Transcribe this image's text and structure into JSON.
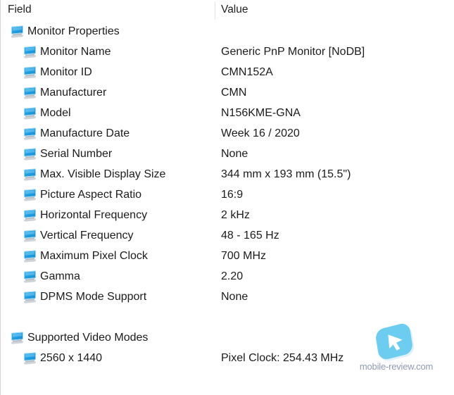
{
  "window": {
    "title": "Monitor Properties"
  },
  "table": {
    "columns": {
      "field": "Field",
      "value": "Value"
    },
    "rows": [
      {
        "level": 0,
        "icon": "monitor-icon",
        "field": "Monitor Properties",
        "value": ""
      },
      {
        "level": 1,
        "icon": "monitor-icon",
        "field": "Monitor Name",
        "value": "Generic PnP Monitor [NoDB]"
      },
      {
        "level": 1,
        "icon": "monitor-icon",
        "field": "Monitor ID",
        "value": "CMN152A"
      },
      {
        "level": 1,
        "icon": "monitor-icon",
        "field": "Manufacturer",
        "value": "CMN"
      },
      {
        "level": 1,
        "icon": "monitor-icon",
        "field": "Model",
        "value": "N156KME-GNA"
      },
      {
        "level": 1,
        "icon": "monitor-icon",
        "field": "Manufacture Date",
        "value": "Week 16 / 2020"
      },
      {
        "level": 1,
        "icon": "monitor-icon",
        "field": "Serial Number",
        "value": "None"
      },
      {
        "level": 1,
        "icon": "monitor-icon",
        "field": "Max. Visible Display Size",
        "value": "344 mm x 193 mm (15.5\")"
      },
      {
        "level": 1,
        "icon": "monitor-icon",
        "field": "Picture Aspect Ratio",
        "value": "16:9"
      },
      {
        "level": 1,
        "icon": "monitor-icon",
        "field": "Horizontal Frequency",
        "value": "2 kHz"
      },
      {
        "level": 1,
        "icon": "monitor-icon",
        "field": "Vertical Frequency",
        "value": "48 - 165 Hz"
      },
      {
        "level": 1,
        "icon": "monitor-icon",
        "field": "Maximum Pixel Clock",
        "value": "700 MHz"
      },
      {
        "level": 1,
        "icon": "monitor-icon",
        "field": "Gamma",
        "value": "2.20"
      },
      {
        "level": 1,
        "icon": "monitor-icon",
        "field": "DPMS Mode Support",
        "value": "None"
      },
      {
        "level": -1,
        "icon": "",
        "field": "",
        "value": ""
      },
      {
        "level": 0,
        "icon": "monitor-icon",
        "field": "Supported Video Modes",
        "value": ""
      },
      {
        "level": 1,
        "icon": "monitor-icon",
        "field": "2560 x 1440",
        "value": "Pixel Clock: 254.43 MHz"
      }
    ]
  },
  "watermark": {
    "logo_icon": "cursor-arrow-badge-icon",
    "text": "mobile-review.com"
  },
  "colors": {
    "icon_blue": "#1e9fe3",
    "logo_blue": "#6ccdf0",
    "text": "#1b1b1b",
    "watermark_text": "#8f9bb3",
    "separator": "#e2e2e2",
    "border": "#d4d4d4"
  }
}
